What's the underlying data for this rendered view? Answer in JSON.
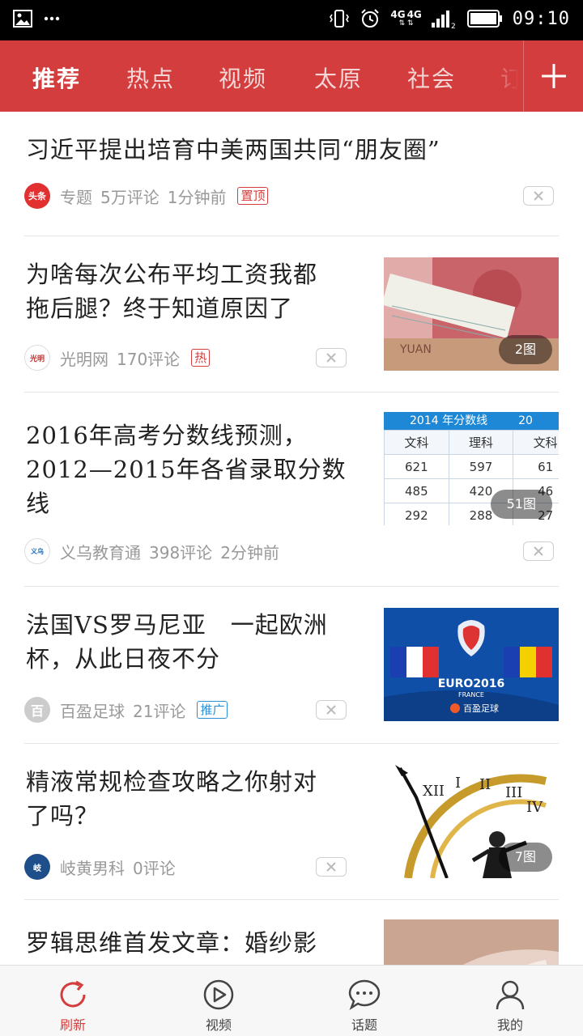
{
  "status_bar": {
    "time": "09:10",
    "net1": "4G",
    "net2": "4G",
    "sim_index": "2"
  },
  "tabs": [
    {
      "label": "推荐",
      "active": true
    },
    {
      "label": "热点"
    },
    {
      "label": "视频"
    },
    {
      "label": "太原"
    },
    {
      "label": "社会"
    },
    {
      "label": "订阅"
    }
  ],
  "feed": [
    {
      "title": "习近平提出培育中美两国共同“朋友圈”",
      "source": "专题",
      "comments": "5万评论",
      "time": "1分钟前",
      "tag": "置顶",
      "source_badge": "头条"
    },
    {
      "title_lines": [
        "为啥每次公布平均工资我都",
        "拖后腿？终于知道原因了"
      ],
      "source": "光明网",
      "comments": "170评论",
      "tag": "热",
      "pic_count": "2图",
      "note_text": "YUAN"
    },
    {
      "title_lines": [
        "2016年高考分数线预测，",
        "2012—2015年各省录取分数",
        "线"
      ],
      "source": "义乌教育通",
      "comments": "398评论",
      "time": "2分钟前",
      "pic_count": "51图",
      "table": {
        "header": "2014 年分数线",
        "header2": "20",
        "cols": [
          "文科",
          "理科",
          "文科"
        ],
        "rows": [
          [
            "621",
            "597",
            "61"
          ],
          [
            "485",
            "420",
            "46"
          ],
          [
            "292",
            "288",
            "27"
          ]
        ]
      }
    },
    {
      "title_lines": [
        "法国VS罗马尼亚　一起欧洲",
        "杯，从此日夜不分"
      ],
      "source": "百盈足球",
      "comments": "21评论",
      "tag": "推广",
      "source_badge": "百",
      "euro_logo": "EURO2016",
      "euro_sub": "FRANCE",
      "euro_brand": "百盈足球"
    },
    {
      "title_lines": [
        "精液常规检查攻略之你射对",
        "了吗？"
      ],
      "source": "岐黄男科",
      "comments": "0评论",
      "pic_count": "7图",
      "numerals": [
        "XII",
        "I",
        "II",
        "III",
        "IV"
      ]
    },
    {
      "title_lines": [
        "罗辑思维首发文章：婚纱影"
      ]
    }
  ],
  "bottom_nav": [
    {
      "label": "刷新",
      "icon": "refresh-icon",
      "active": true
    },
    {
      "label": "视频",
      "icon": "play-icon"
    },
    {
      "label": "话题",
      "icon": "chat-icon"
    },
    {
      "label": "我的",
      "icon": "user-icon"
    }
  ],
  "colors": {
    "brand": "#d43d3d",
    "tag_blue": "#2e8fd6",
    "meta_gray": "#999999"
  }
}
